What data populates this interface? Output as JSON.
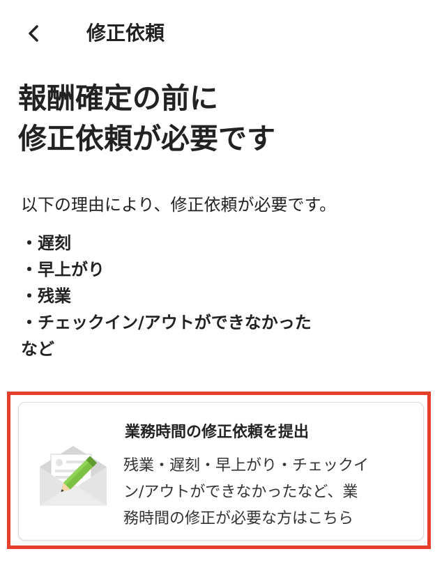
{
  "header": {
    "back_icon": "chevron-left-icon",
    "title": "修正依頼"
  },
  "headline": {
    "line1": "報酬確定の前に",
    "line2": "修正依頼が必要です"
  },
  "intro": "以下の理由により、修正依頼が必要です。",
  "reasons": [
    "・遅刻",
    "・早上がり",
    "・残業",
    "・チェックイン/アウトができなかった",
    "など"
  ],
  "card": {
    "icon": "envelope-pencil-icon",
    "title": "業務時間の修正依頼を提出",
    "desc_lines": [
      "残業・遅刻・早上がり・チェックイ",
      "ン/アウトができなかったなど、業",
      "務時間の修正が必要な方はこちら"
    ],
    "highlight_color": "#e53e2b"
  }
}
